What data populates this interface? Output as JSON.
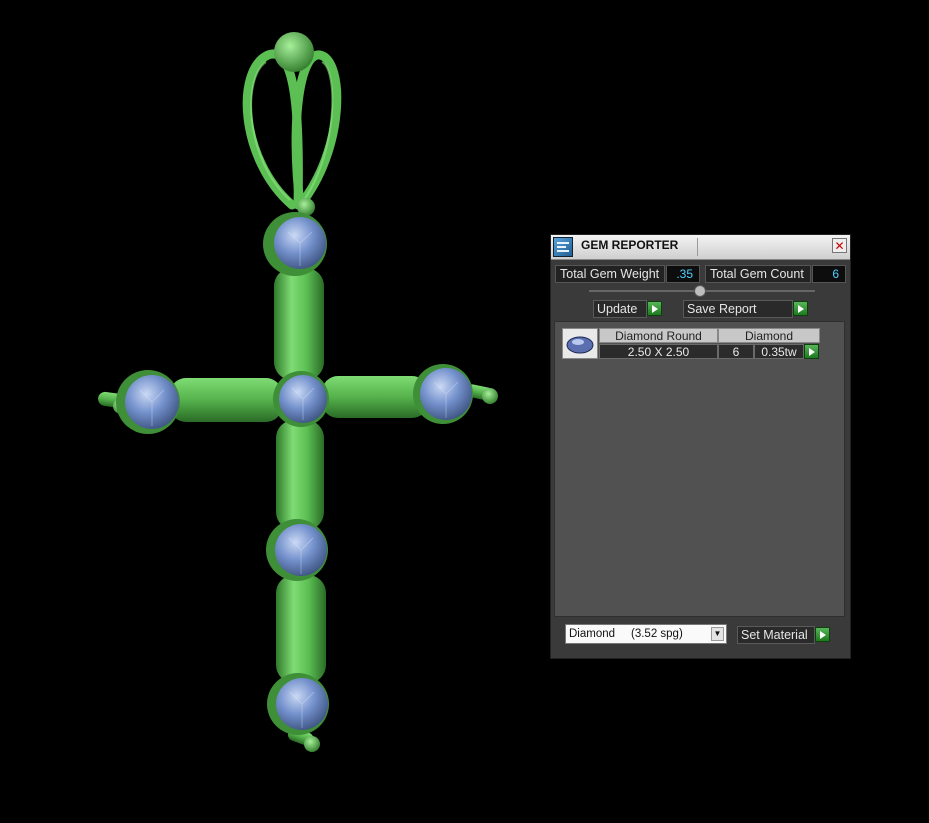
{
  "panel": {
    "title": "GEM REPORTER",
    "close_icon": "close-icon",
    "total_weight_label": "Total Gem Weight",
    "total_weight_value": ".35",
    "total_count_label": "Total Gem Count",
    "total_count_value": "6",
    "update_label": "Update",
    "save_report_label": "Save Report",
    "set_material_label": "Set Material",
    "material_selected": "Diamond     (3.52 spg)"
  },
  "gem_table": {
    "headers": [
      "Diamond Round",
      "Diamond"
    ],
    "rows": [
      {
        "size": "2.50 X 2.50",
        "count": "6",
        "weight": "0.35tw"
      }
    ]
  },
  "model": {
    "metal_color": "#5cbf53",
    "gem_color": "#6b8ac4",
    "background": "#000000"
  }
}
